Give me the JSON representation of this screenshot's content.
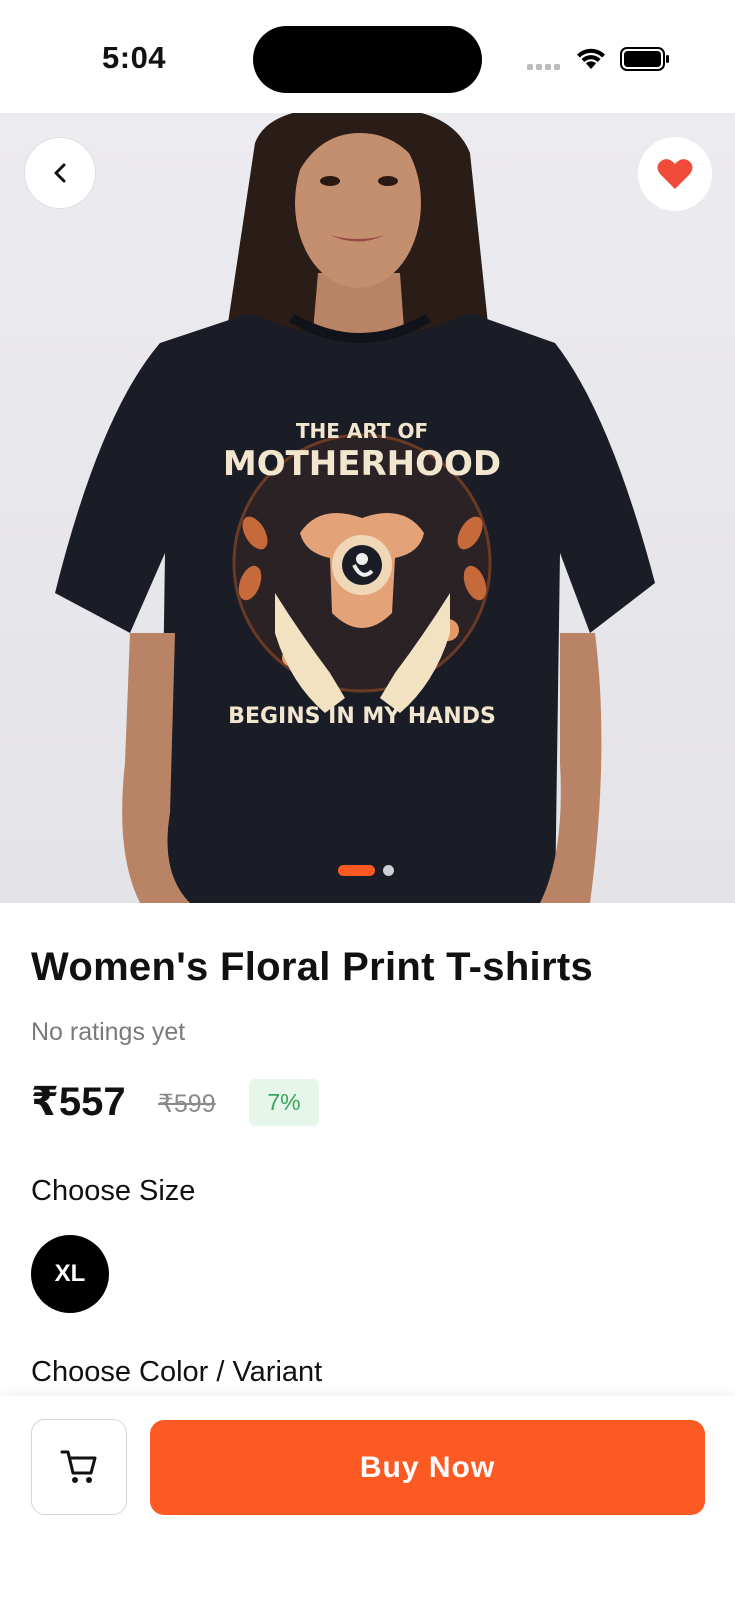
{
  "status_bar": {
    "time": "5:04"
  },
  "hero": {
    "shirt_print_line1": "THE ART OF",
    "shirt_print_line2": "MOTHERHOOD",
    "shirt_print_line3": "BEGINS IN MY HANDS",
    "carousel_total": 2,
    "carousel_active": 1
  },
  "product": {
    "title": "Women's Floral Print T-shirts",
    "ratings_text": "No ratings yet",
    "price": "₹557",
    "mrp": "₹599",
    "discount": "7%"
  },
  "size": {
    "label": "Choose Size",
    "options": [
      "XL"
    ],
    "selected": "XL"
  },
  "variant": {
    "label": "Choose Color / Variant"
  },
  "actions": {
    "buy_label": "Buy Now"
  },
  "colors": {
    "accent": "#fc5a22",
    "heart": "#f04a3a",
    "discount_bg": "#e6f6ea",
    "discount_text": "#3aa55a"
  }
}
